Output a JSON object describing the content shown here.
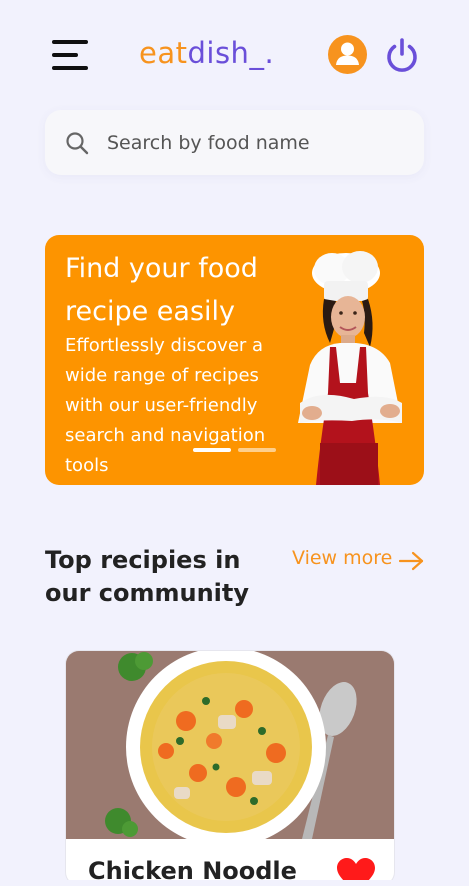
{
  "header": {
    "logo_part1": "eat",
    "logo_part2": "dish_.",
    "menu_icon": "hamburger-menu-icon",
    "profile_icon": "user-icon",
    "logout_icon": "power-icon"
  },
  "search": {
    "placeholder": "Search by food name",
    "value": "",
    "icon": "search-icon"
  },
  "banner": {
    "title": "Find your food recipe easily",
    "text": "Effortlessly discover a wide range of recipes with our user-friendly search and navigation tools",
    "active_slide": 1,
    "slide_count": 2,
    "image": "chef-woman-illustration"
  },
  "section": {
    "title": "Top recipies in our community",
    "view_more": "View more",
    "view_more_icon": "arrow-right-icon"
  },
  "recipes": [
    {
      "title": "Chicken Noodle",
      "image": "chicken-noodle-soup-photo",
      "favorite_icon": "heart-icon",
      "favorited": true
    }
  ],
  "colors": {
    "background": "#f2f2fd",
    "accent_orange": "#f7931e",
    "banner_orange": "#fd9400",
    "accent_purple": "#6a4fd9",
    "heart_red": "#ff1a1a"
  }
}
